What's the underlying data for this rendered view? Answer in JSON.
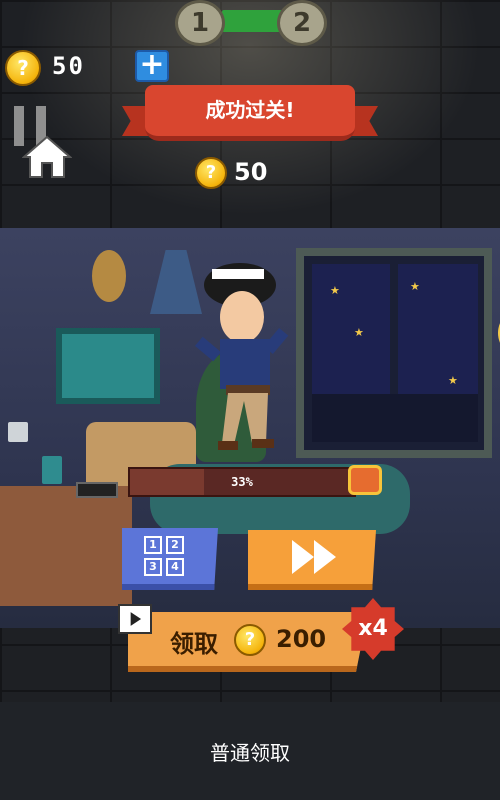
{
  "level": {
    "current": "1",
    "next": "2"
  },
  "wallet": {
    "coin_symbol": "?",
    "count": "50"
  },
  "result": {
    "title": "成功过关!",
    "reward_amount": "50"
  },
  "progress": {
    "percent": 33,
    "label": "33%"
  },
  "actions": {
    "claim_label": "领取",
    "claim_amount": "200",
    "multiplier": "x4",
    "normal_claim": "普通领取"
  },
  "level_grid": [
    "1",
    "2",
    "3",
    "4"
  ],
  "icons": [
    "plus-icon",
    "pause-icon",
    "home-icon",
    "treasure-chest-icon",
    "level-grid-icon",
    "fast-forward-icon",
    "video-ad-icon"
  ],
  "colors": {
    "banner": "#d9462f",
    "claim_button": "#f0a24a",
    "choose_level": "#5c75d8",
    "level_bar": "#2fa23c",
    "multiplier": "#d63b2b"
  }
}
